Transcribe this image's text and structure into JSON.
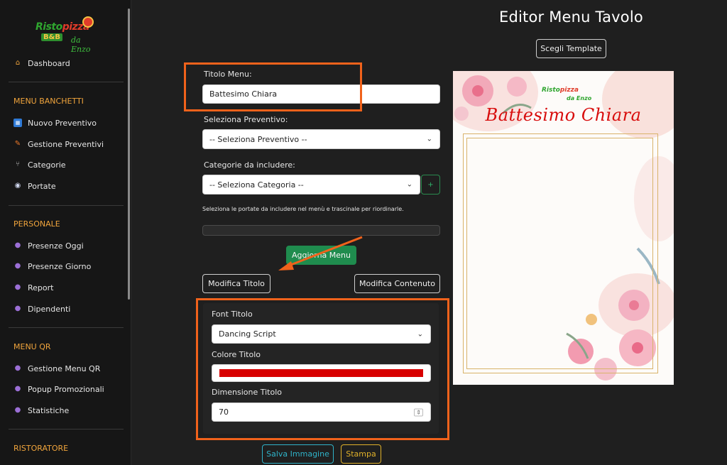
{
  "sidebar": {
    "logo": {
      "top": "Ristopizza",
      "top_a": "Risto",
      "top_b": "pizza",
      "bb": "B&B",
      "sub": "da Enzo"
    },
    "dashboard": "Dashboard",
    "sections": {
      "banchetti": "MENU BANCHETTI",
      "personale": "PERSONALE",
      "qr": "MENU QR",
      "ristoratore": "RISTORATORE"
    },
    "items": {
      "nuovo_preventivo": "Nuovo Preventivo",
      "gestione_preventivi": "Gestione Preventivi",
      "categorie": "Categorie",
      "portate": "Portate",
      "presenze_oggi": "Presenze Oggi",
      "presenze_giorno": "Presenze Giorno",
      "report": "Report",
      "dipendenti": "Dipendenti",
      "gestione_menu_qr": "Gestione Menu QR",
      "popup_promozionali": "Popup Promozionali",
      "statistiche": "Statistiche"
    },
    "icons": {
      "dashboard": "house-icon",
      "nuovo_preventivo": "calendar-icon",
      "gestione_preventivi": "pencil-icon",
      "categorie": "utensils-icon",
      "portate": "dish-icon",
      "person": "user-icon"
    }
  },
  "main": {
    "title": "Editor Menu Tavolo",
    "template_button": "Scegli Template",
    "titolo_menu_label": "Titolo Menu:",
    "titolo_menu_value": "Battesimo Chiara",
    "preventivo_label": "Seleziona Preventivo:",
    "preventivo_value": "-- Seleziona Preventivo --",
    "categorie_label": "Categorie da includere:",
    "categorie_value": "-- Seleziona Categoria --",
    "add_category": "+",
    "portate_hint": "Seleziona le portate da includere nel menù e trascinale per riordinarle.",
    "aggiorna_button": "Aggiorna Menu",
    "modifica_titolo": "Modifica Titolo",
    "modifica_contenuto": "Modifica Contenuto",
    "font_titolo_label": "Font Titolo",
    "font_titolo_value": "Dancing Script",
    "colore_titolo_label": "Colore Titolo",
    "colore_titolo_value": "#d80000",
    "dimensione_label": "Dimensione Titolo",
    "dimensione_value": "70",
    "salva_button": "Salva Immagine",
    "stampa_button": "Stampa"
  },
  "preview": {
    "title": "Battesimo Chiara",
    "logo_a": "Risto",
    "logo_b": "pizza",
    "logo_sub": "da Enzo"
  },
  "colors": {
    "accent_orange": "#f0621b",
    "section_title": "#f0a43c",
    "green_button": "#1f8c4e",
    "salva_border": "#2fb3c9",
    "stampa_border": "#e0b12a"
  }
}
